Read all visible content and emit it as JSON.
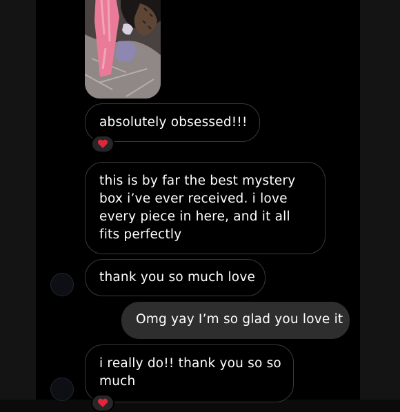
{
  "messages": [
    {
      "text": "absolutely obsessed!!!",
      "reaction": "heart-icon"
    },
    {
      "text": "this is by far the best mystery box i’ve ever received. i love every piece in here, and it all fits perfectly"
    },
    {
      "text": "thank you so much love"
    },
    {
      "text": "Omg yay I’m so glad you love it"
    },
    {
      "text": "i really do!! thank you so so much",
      "reaction": "heart-icon"
    }
  ],
  "colors": {
    "reaction_heart": "#e0263c",
    "outgoing_bubble": "#2e2e2e",
    "incoming_border": "#3a3a3a"
  }
}
